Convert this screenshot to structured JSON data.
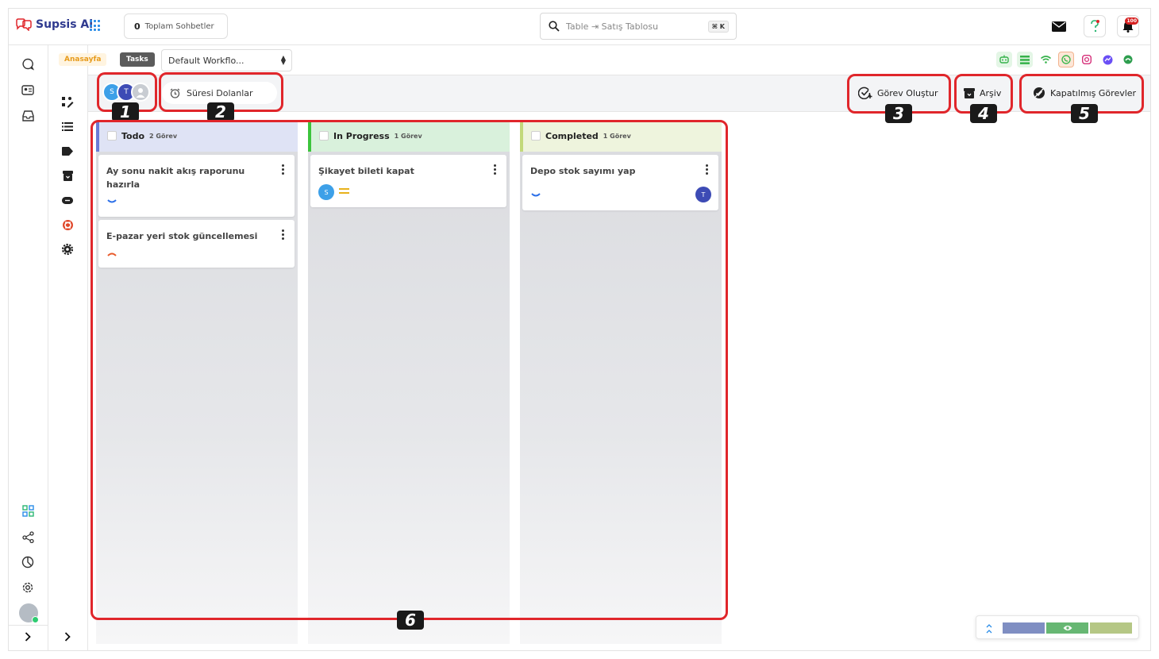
{
  "app": {
    "name": "Supsis Ai"
  },
  "header": {
    "chat_count_value": "0",
    "chat_count_label": "Toplam Sohbetler",
    "search_placeholder": "Table ⇥ Satış Tablosu",
    "search_shortcut": "⌘ K",
    "notification_count": "100"
  },
  "breadcrumb": {
    "home": "Anasayfa",
    "current": "Tasks",
    "workflow_select": "Default Workflo..."
  },
  "toolbar": {
    "avatars": [
      "S",
      "T",
      ""
    ],
    "expired_label": "Süresi Dolanlar",
    "create_task": "Görev Oluştur",
    "archive": "Arşiv",
    "closed_tasks": "Kapatılmış Görevler"
  },
  "columns": [
    {
      "title": "Todo",
      "count": "2 Görev",
      "color": "#6a7bd6",
      "bg": "#dfe3f5",
      "cards": [
        {
          "title": "Ay sonu nakit akış raporunu hazırla",
          "priority": "low"
        },
        {
          "title": "E-pazar yeri stok güncellemesi",
          "priority": "high"
        }
      ]
    },
    {
      "title": "In Progress",
      "count": "1 Görev",
      "color": "#3cc43c",
      "bg": "#d9f1dc",
      "cards": [
        {
          "title": "Şikayet bileti kapat",
          "priority": "medium",
          "assignee": "S"
        }
      ]
    },
    {
      "title": "Completed",
      "count": "1 Görev",
      "color": "#c2d97a",
      "bg": "#eef4dd",
      "cards": [
        {
          "title": "Depo stok sayımı yap",
          "priority": "low",
          "assignee": "T"
        }
      ]
    }
  ],
  "annotations": [
    "1",
    "2",
    "3",
    "4",
    "5",
    "6"
  ],
  "colors": {
    "accent": "#e0262b",
    "brand": "#2f3a8f"
  }
}
